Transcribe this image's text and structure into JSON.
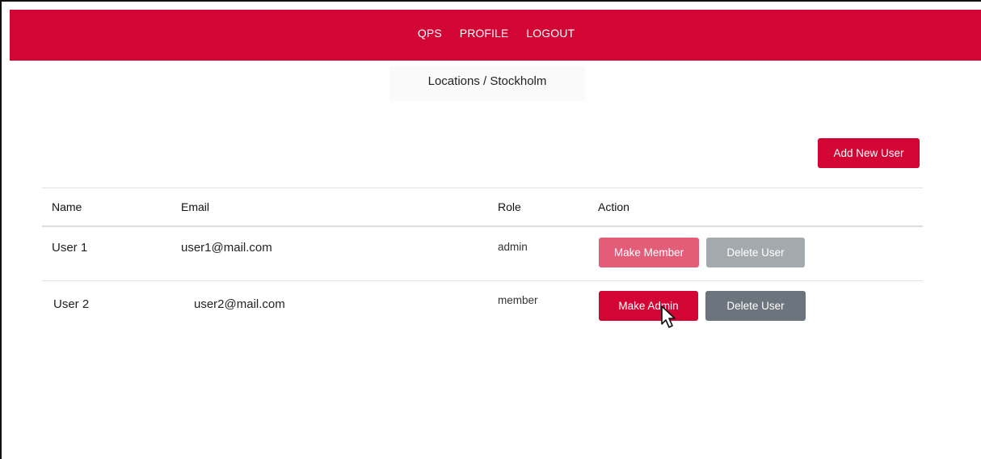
{
  "nav": {
    "items": [
      {
        "label": "QPS"
      },
      {
        "label": "PROFILE"
      },
      {
        "label": "LOGOUT"
      }
    ]
  },
  "breadcrumb": "Locations / Stockholm",
  "add_user_label": "Add New User",
  "table": {
    "headers": [
      "Name",
      "Email",
      "Role",
      "Action"
    ],
    "rows": [
      {
        "name": "User 1",
        "email": "user1@mail.com",
        "role": "admin",
        "role_action": "Make Member",
        "delete_action": "Delete User"
      },
      {
        "name": "User 2",
        "email": "user2@mail.com",
        "role": "member",
        "role_action": "Make Admin",
        "delete_action": "Delete User"
      }
    ]
  },
  "colors": {
    "brand": "#d30535",
    "brand_faded": "#e35c78",
    "secondary": "#6c757d",
    "secondary_faded": "#a4a9ae"
  }
}
